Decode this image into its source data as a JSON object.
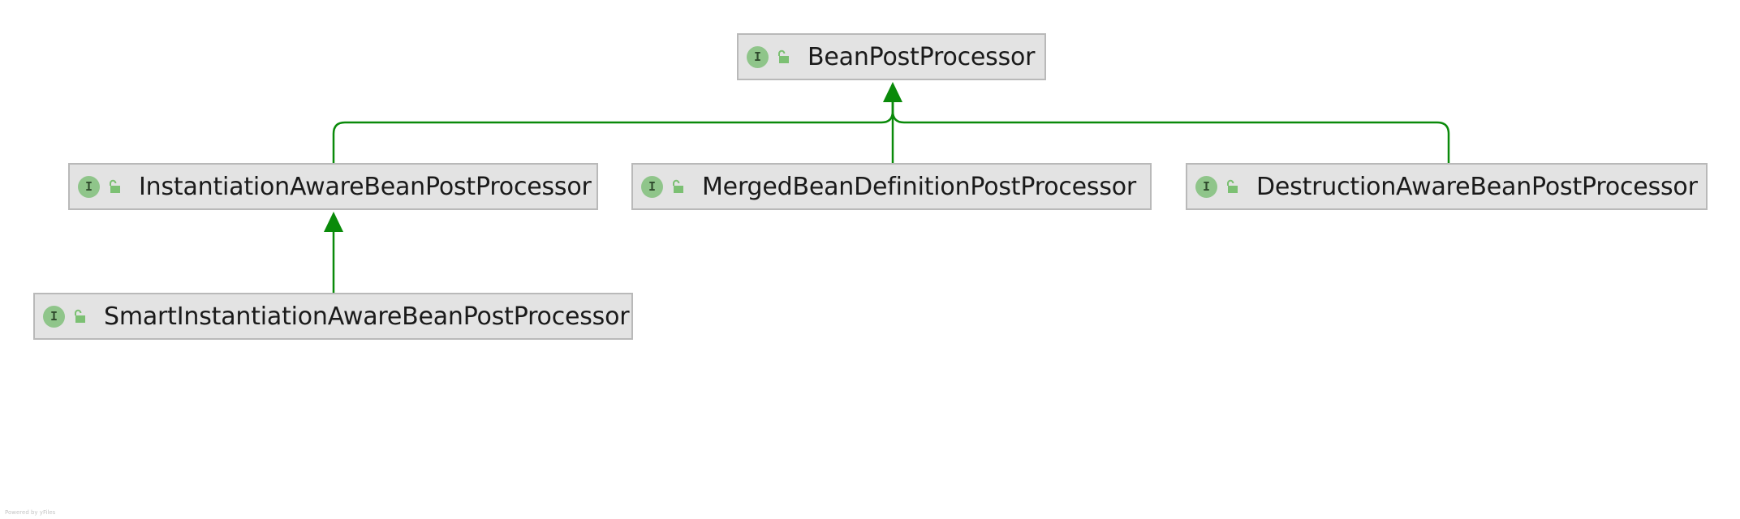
{
  "diagram": {
    "nodes": [
      {
        "id": "bean-post-processor",
        "badge": "I",
        "access": "unlock-icon",
        "label": "BeanPostProcessor"
      },
      {
        "id": "instantiation-aware",
        "badge": "I",
        "access": "unlock-icon",
        "label": "InstantiationAwareBeanPostProcessor"
      },
      {
        "id": "merged-bean-definition",
        "badge": "I",
        "access": "unlock-icon",
        "label": "MergedBeanDefinitionPostProcessor"
      },
      {
        "id": "destruction-aware",
        "badge": "I",
        "access": "unlock-icon",
        "label": "DestructionAwareBeanPostProcessor"
      },
      {
        "id": "smart-instantiation-aware",
        "badge": "I",
        "access": "unlock-icon",
        "label": "SmartInstantiationAwareBeanPostProcessor"
      }
    ],
    "edges": [
      {
        "from": "instantiation-aware",
        "to": "bean-post-processor",
        "kind": "extends"
      },
      {
        "from": "merged-bean-definition",
        "to": "bean-post-processor",
        "kind": "extends"
      },
      {
        "from": "destruction-aware",
        "to": "bean-post-processor",
        "kind": "extends"
      },
      {
        "from": "smart-instantiation-aware",
        "to": "instantiation-aware",
        "kind": "extends"
      }
    ],
    "colors": {
      "edge": "#0a8a0a",
      "node_fill": "#e3e3e3",
      "node_border": "#b9b9b9",
      "badge": "#8fc58a",
      "lock": "#7cc073"
    }
  },
  "footer": {
    "credit": "Powered by yFiles"
  }
}
